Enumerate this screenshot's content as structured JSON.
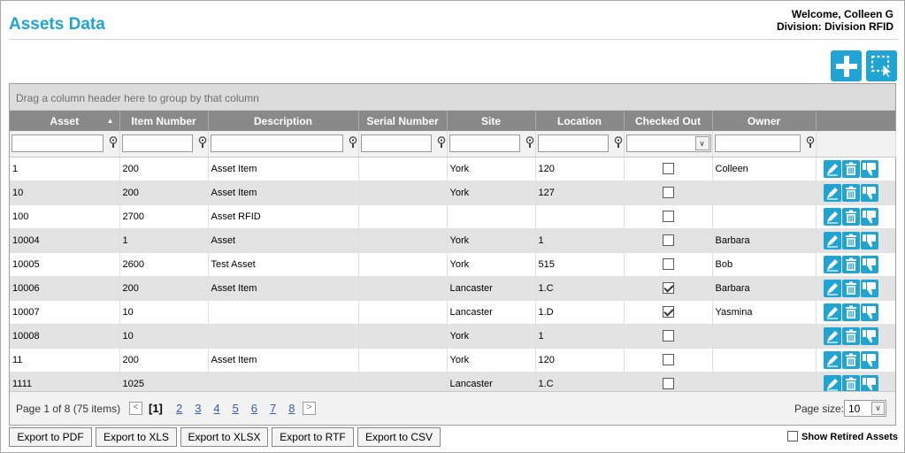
{
  "header": {
    "title": "Assets Data",
    "welcome": "Welcome, Colleen G",
    "division": "Division: Division RFID"
  },
  "toolbar": {
    "add_icon": "plus-icon",
    "select_icon": "selection-cursor-icon"
  },
  "grid": {
    "group_panel": "Drag a column header here to group by that column",
    "columns": [
      "Asset",
      "Item Number",
      "Description",
      "Serial Number",
      "Site",
      "Location",
      "Checked Out",
      "Owner"
    ],
    "sort_indicator": "▲",
    "rows": [
      {
        "asset": "1",
        "item": "200",
        "desc": "Asset Item",
        "serial": "",
        "site": "York",
        "location": "120",
        "checked": false,
        "owner": "Colleen"
      },
      {
        "asset": "10",
        "item": "200",
        "desc": "Asset Item",
        "serial": "",
        "site": "York",
        "location": "127",
        "checked": false,
        "owner": ""
      },
      {
        "asset": "100",
        "item": "2700",
        "desc": "Asset RFID",
        "serial": "",
        "site": "",
        "location": "",
        "checked": false,
        "owner": ""
      },
      {
        "asset": "10004",
        "item": "1",
        "desc": "Asset",
        "serial": "",
        "site": "York",
        "location": "1",
        "checked": false,
        "owner": "Barbara"
      },
      {
        "asset": "10005",
        "item": "2600",
        "desc": "Test Asset",
        "serial": "",
        "site": "York",
        "location": "515",
        "checked": false,
        "owner": "Bob"
      },
      {
        "asset": "10006",
        "item": "200",
        "desc": "Asset Item",
        "serial": "",
        "site": "Lancaster",
        "location": "1.C",
        "checked": true,
        "owner": "Barbara"
      },
      {
        "asset": "10007",
        "item": "10",
        "desc": "",
        "serial": "",
        "site": "Lancaster",
        "location": "1.D",
        "checked": true,
        "owner": "Yasmina"
      },
      {
        "asset": "10008",
        "item": "10",
        "desc": "",
        "serial": "",
        "site": "York",
        "location": "1",
        "checked": false,
        "owner": ""
      },
      {
        "asset": "11",
        "item": "200",
        "desc": "Asset Item",
        "serial": "",
        "site": "York",
        "location": "120",
        "checked": false,
        "owner": ""
      },
      {
        "asset": "1111",
        "item": "1025",
        "desc": "",
        "serial": "",
        "site": "Lancaster",
        "location": "1.C",
        "checked": false,
        "owner": ""
      }
    ],
    "row_actions": [
      "edit-icon",
      "delete-icon",
      "retire-icon"
    ]
  },
  "pager": {
    "summary": "Page 1 of 8 (75 items)",
    "prev": "<",
    "next": ">",
    "current": "[1]",
    "pages": [
      "2",
      "3",
      "4",
      "5",
      "6",
      "7",
      "8"
    ],
    "page_size_label": "Page size:",
    "page_size": "10"
  },
  "export": {
    "pdf": "Export to PDF",
    "xls": "Export to XLS",
    "xlsx": "Export to XLSX",
    "rtf": "Export to RTF",
    "csv": "Export to CSV"
  },
  "show_retired": {
    "label": "Show Retired Assets",
    "checked": false
  },
  "colors": {
    "accent": "#1fa4d3",
    "header_bg": "#898989",
    "alt_row": "#e3e3e3"
  }
}
